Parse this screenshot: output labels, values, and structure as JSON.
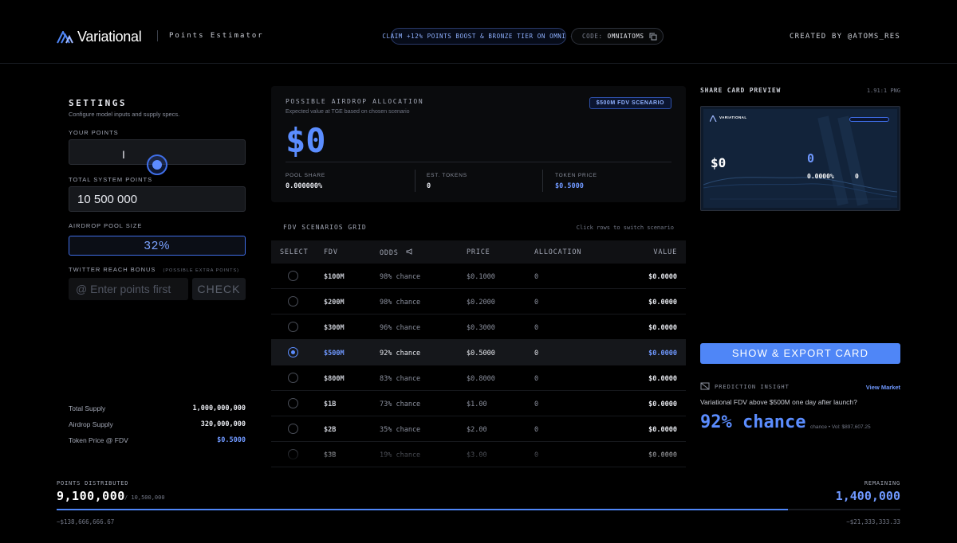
{
  "header": {
    "brand": "Variational",
    "subtitle": "Points Estimator",
    "claim_pill": "CLAIM +12% POINTS BOOST & BRONZE TIER ON OMNI",
    "code_label": "CODE:",
    "code_value": "OMNIATOMS",
    "created_by": "CREATED BY @ATOMS_RES"
  },
  "settings": {
    "title": "SETTINGS",
    "subtitle": "Configure model inputs and supply specs.",
    "your_points_label": "YOUR POINTS",
    "your_points_value": "",
    "total_system_points_label": "TOTAL SYSTEM POINTS",
    "total_system_points_value": "10 500 000",
    "airdrop_pool_label": "AIRDROP POOL SIZE",
    "airdrop_pool_value": "32%",
    "twitter_label": "TWITTER REACH BONUS",
    "twitter_note": "(POSSIBLE EXTRA POINTS)",
    "twitter_placeholder": "@ Enter points first",
    "check_label": "CHECK",
    "summary": [
      {
        "key": "Total Supply",
        "value": "1,000,000,000"
      },
      {
        "key": "Airdrop Supply",
        "value": "320,000,000"
      },
      {
        "key": "Token Price @ FDV",
        "value": "$0.5000"
      }
    ]
  },
  "allocation": {
    "title": "POSSIBLE AIRDROP ALLOCATION",
    "subtitle": "Expected value at TGE based on chosen scenario",
    "badge": "$500M FDV SCENARIO",
    "value": "$0",
    "pool_share_label": "POOL SHARE",
    "pool_share_value": "0.000000%",
    "est_tokens_label": "EST. TOKENS",
    "est_tokens_value": "0",
    "token_price_label": "TOKEN PRICE",
    "token_price_value": "$0.5000"
  },
  "grid": {
    "title": "FDV SCENARIOS GRID",
    "hint": "Click rows to switch scenario",
    "headers": {
      "select": "SELECT",
      "fdv": "FDV",
      "odds": "ODDS",
      "price": "PRICE",
      "allocation": "ALLOCATION",
      "value": "VALUE"
    },
    "rows": [
      {
        "fdv": "$100M",
        "odds": "98% chance",
        "price": "$0.1000",
        "allocation": "0",
        "value": "$0.0000",
        "selected": false
      },
      {
        "fdv": "$200M",
        "odds": "98% chance",
        "price": "$0.2000",
        "allocation": "0",
        "value": "$0.0000",
        "selected": false
      },
      {
        "fdv": "$300M",
        "odds": "96% chance",
        "price": "$0.3000",
        "allocation": "0",
        "value": "$0.0000",
        "selected": false
      },
      {
        "fdv": "$500M",
        "odds": "92% chance",
        "price": "$0.5000",
        "allocation": "0",
        "value": "$0.0000",
        "selected": true
      },
      {
        "fdv": "$800M",
        "odds": "83% chance",
        "price": "$0.8000",
        "allocation": "0",
        "value": "$0.0000",
        "selected": false
      },
      {
        "fdv": "$1B",
        "odds": "73% chance",
        "price": "$1.00",
        "allocation": "0",
        "value": "$0.0000",
        "selected": false
      },
      {
        "fdv": "$2B",
        "odds": "35% chance",
        "price": "$2.00",
        "allocation": "0",
        "value": "$0.0000",
        "selected": false
      },
      {
        "fdv": "$3B",
        "odds": "19% chance",
        "price": "$3.00",
        "allocation": "0",
        "value": "$0.0000",
        "selected": false
      }
    ]
  },
  "share": {
    "title": "SHARE CARD PREVIEW",
    "ratio": "1.91:1 PNG",
    "card_brand": "VARIATIONAL",
    "card_value": "$0",
    "card_points": "0",
    "card_pool_share": "0.0000%",
    "card_tokens": "0",
    "show_button": "SHOW & EXPORT CARD"
  },
  "insight": {
    "label": "PREDICTION INSIGHT",
    "view_market": "View Market",
    "question": "Variational FDV above $500M one day after launch?",
    "percent": "92% chance",
    "volume": "chance • Vol: $897,607.25"
  },
  "progress": {
    "distributed_label": "POINTS DISTRIBUTED",
    "distributed_value": "9,100,000",
    "distributed_of": "/ 10,500,000",
    "remaining_label": "REMAINING",
    "remaining_value": "1,400,000",
    "fraction": 0.8667,
    "left_note": "~$138,666,666.67",
    "right_note": "~$21,333,333.33"
  },
  "colors": {
    "accent": "#5b8dff",
    "background": "#000000",
    "button": "#4f86f7"
  }
}
